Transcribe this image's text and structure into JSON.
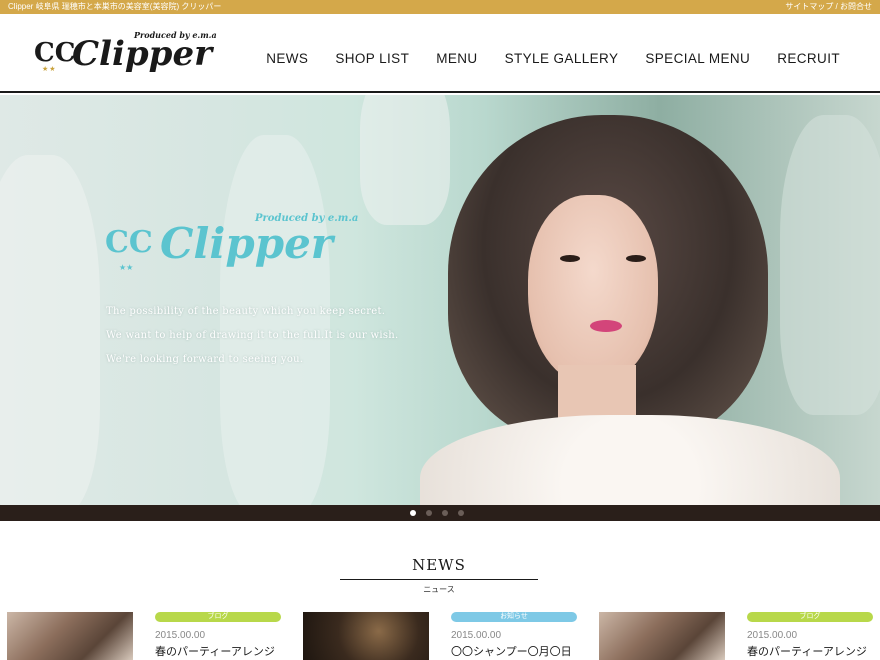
{
  "topbar": {
    "tagline": "Clipper 岐阜県 瑞穂市と本巣市の美容室(美容院) クリッパー",
    "links": "サイトマップ / お問合せ"
  },
  "header": {
    "logo_mark": "CC",
    "logo_word": "Clipper",
    "logo_tagline": "Produced by e.m.a",
    "nav": [
      "NEWS",
      "SHOP LIST",
      "MENU",
      "STYLE GALLERY",
      "SPECIAL MENU",
      "RECRUIT"
    ]
  },
  "hero": {
    "logo_mark": "CC",
    "logo_word": "Clipper",
    "logo_tagline": "Produced by e.m.a",
    "copy": [
      "The possibility of the beauty which you keep secret.",
      "We want to help of drawing it to the full.It is our wish.",
      "We're looking forward to seeing you."
    ],
    "slides": 4,
    "active_slide": 1
  },
  "news": {
    "heading": "NEWS",
    "subheading": "ニュース",
    "items": [
      {
        "badge": "ブログ",
        "badge_color": "#b8d84a",
        "date": "2015.00.00",
        "title": "春のパーティーアレンジ",
        "thumb": "hair"
      },
      {
        "badge": "お知らせ",
        "badge_color": "#7ec9e6",
        "date": "2015.00.00",
        "title": "〇〇シャンプー〇月〇日",
        "thumb": "shop"
      },
      {
        "badge": "ブログ",
        "badge_color": "#b8d84a",
        "date": "2015.00.00",
        "title": "春のパーティーアレンジ",
        "thumb": "hair"
      }
    ]
  },
  "colors": {
    "topbar": "#d4a84a",
    "accent_teal": "#5bc4cf",
    "dark": "#1a1a1a"
  }
}
